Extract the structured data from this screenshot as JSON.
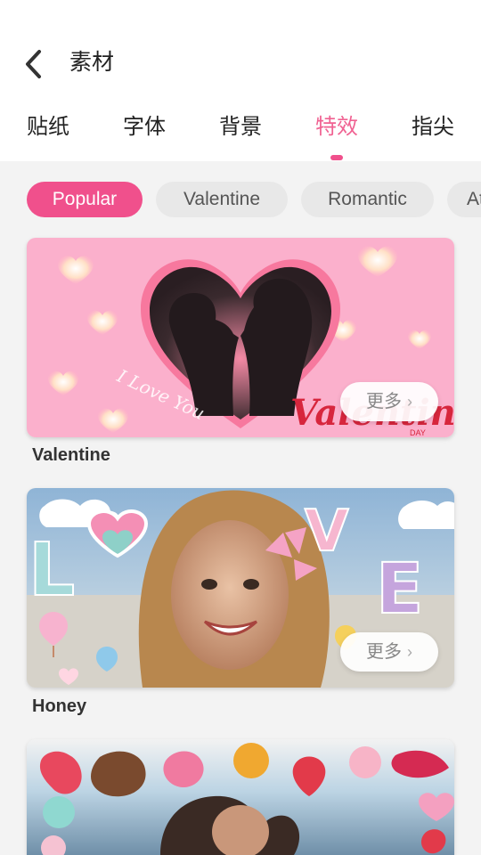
{
  "header": {
    "title": "素材",
    "back_icon": "chevron-left-icon"
  },
  "tabs": [
    {
      "label": "贴纸",
      "active": false
    },
    {
      "label": "字体",
      "active": false
    },
    {
      "label": "背景",
      "active": false
    },
    {
      "label": "特效",
      "active": true
    },
    {
      "label": "指尖",
      "active": false
    }
  ],
  "chips": [
    {
      "label": "Popular",
      "active": true
    },
    {
      "label": "Valentine",
      "active": false
    },
    {
      "label": "Romantic",
      "active": false
    },
    {
      "label": "At",
      "active": false
    }
  ],
  "cards": [
    {
      "name": "Valentine",
      "more_label": "更多",
      "art_text": "I Love You",
      "art_title": "Valentines",
      "art_small": "DAY"
    },
    {
      "name": "Honey",
      "more_label": "更多",
      "art_letters": [
        "L",
        "V",
        "E"
      ]
    },
    {
      "name": "",
      "more_label": ""
    }
  ],
  "colors": {
    "accent": "#f0508c",
    "active_tab": "#f06292",
    "background": "#f3f3f3"
  }
}
